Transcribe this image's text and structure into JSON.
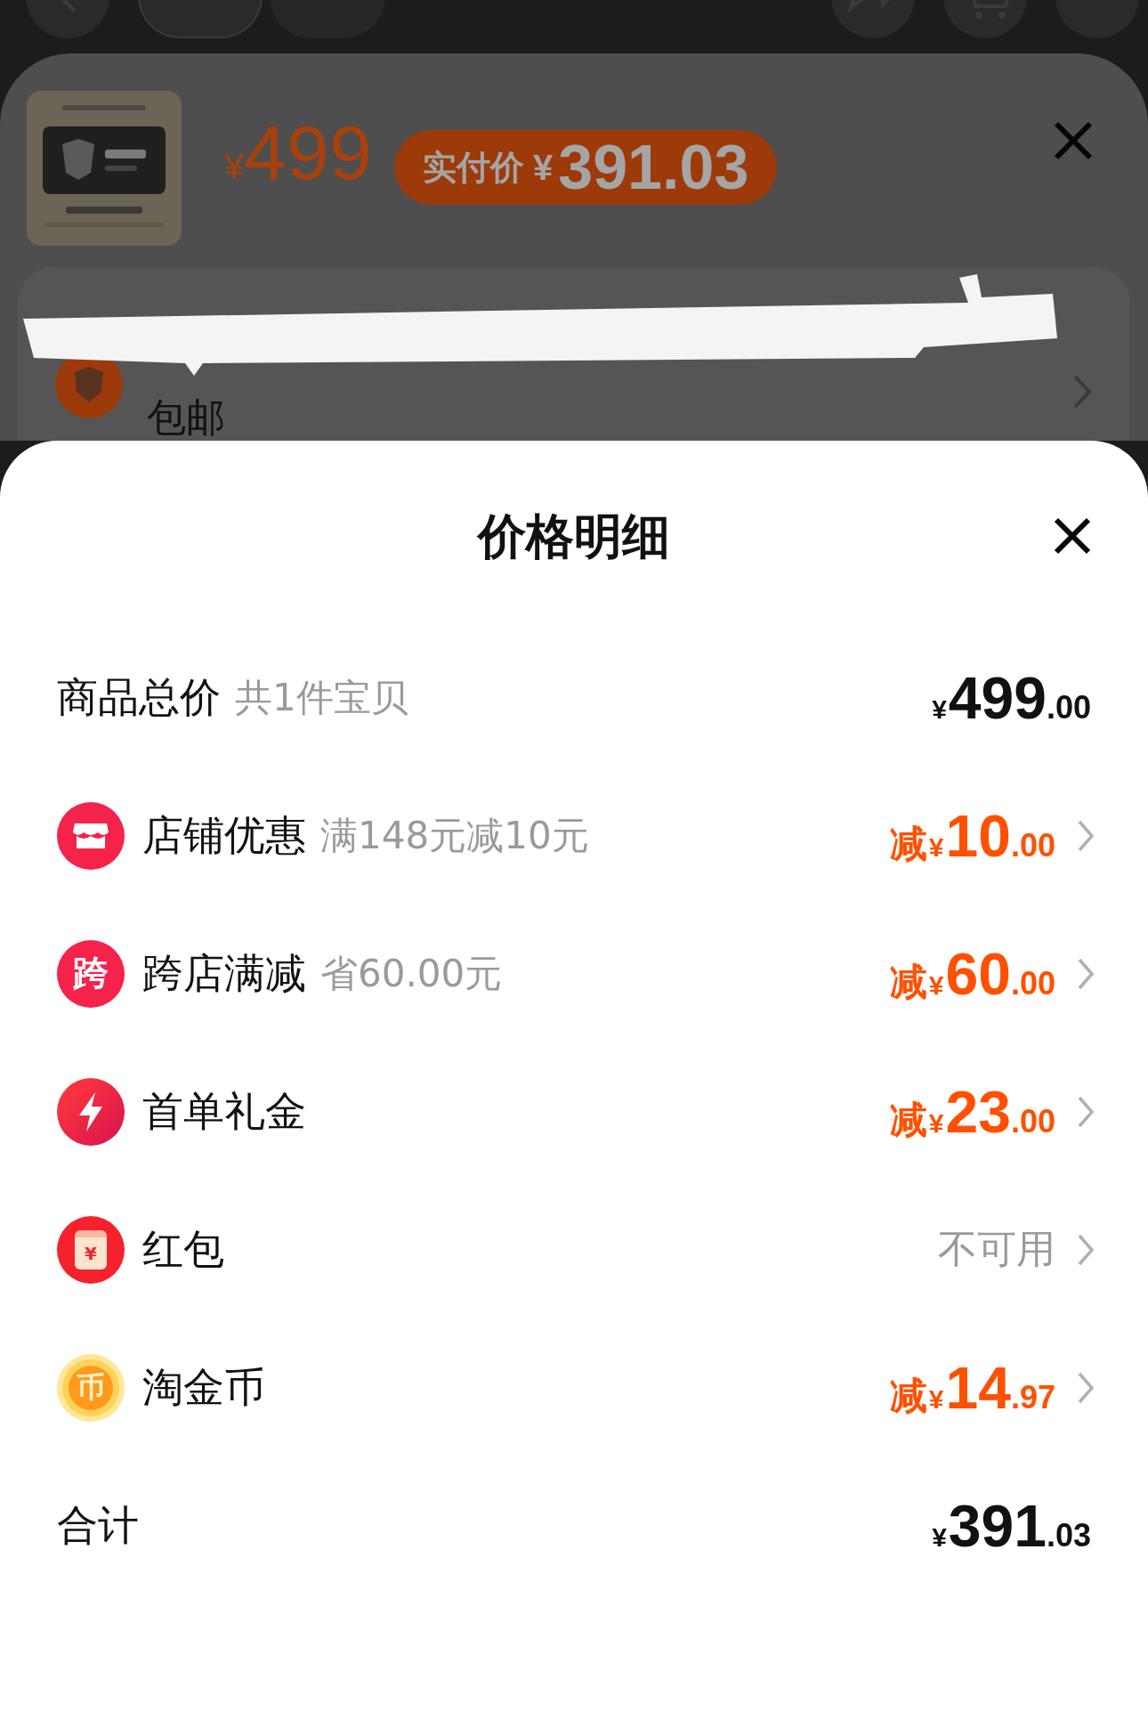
{
  "background_page": {
    "product": {
      "kind": "picture",
      "price_currency": "¥",
      "price": "499",
      "pay_label": "实付价",
      "pay_currency": "¥",
      "pay_amount": "391.03"
    },
    "shipping": "包邮"
  },
  "sheet": {
    "title": "价格明细",
    "rows": [
      {
        "kind": "total",
        "label": "商品总价",
        "note": "共1件宝贝",
        "amount": {
          "currency": "¥",
          "integer": "499",
          "decimal": ".00"
        }
      },
      {
        "kind": "discount",
        "label": "店铺优惠",
        "note": "满148元减10元",
        "amount": {
          "prefix": "减",
          "currency": "¥",
          "integer": "10",
          "decimal": ".00"
        }
      },
      {
        "kind": "discount",
        "icon_text": "跨",
        "label": "跨店满减",
        "note": "省60.00元",
        "amount": {
          "prefix": "减",
          "currency": "¥",
          "integer": "60",
          "decimal": ".00"
        }
      },
      {
        "kind": "discount",
        "label": "首单礼金",
        "amount": {
          "prefix": "减",
          "currency": "¥",
          "integer": "23",
          "decimal": ".00"
        }
      },
      {
        "kind": "status",
        "icon_text": "¥",
        "label": "红包",
        "status": "不可用"
      },
      {
        "kind": "discount",
        "icon_text": "币",
        "label": "淘金币",
        "amount": {
          "prefix": "减",
          "currency": "¥",
          "integer": "14",
          "decimal": ".97"
        }
      },
      {
        "kind": "total",
        "label": "合计",
        "amount": {
          "currency": "¥",
          "integer": "391",
          "decimal": ".03"
        }
      }
    ]
  }
}
